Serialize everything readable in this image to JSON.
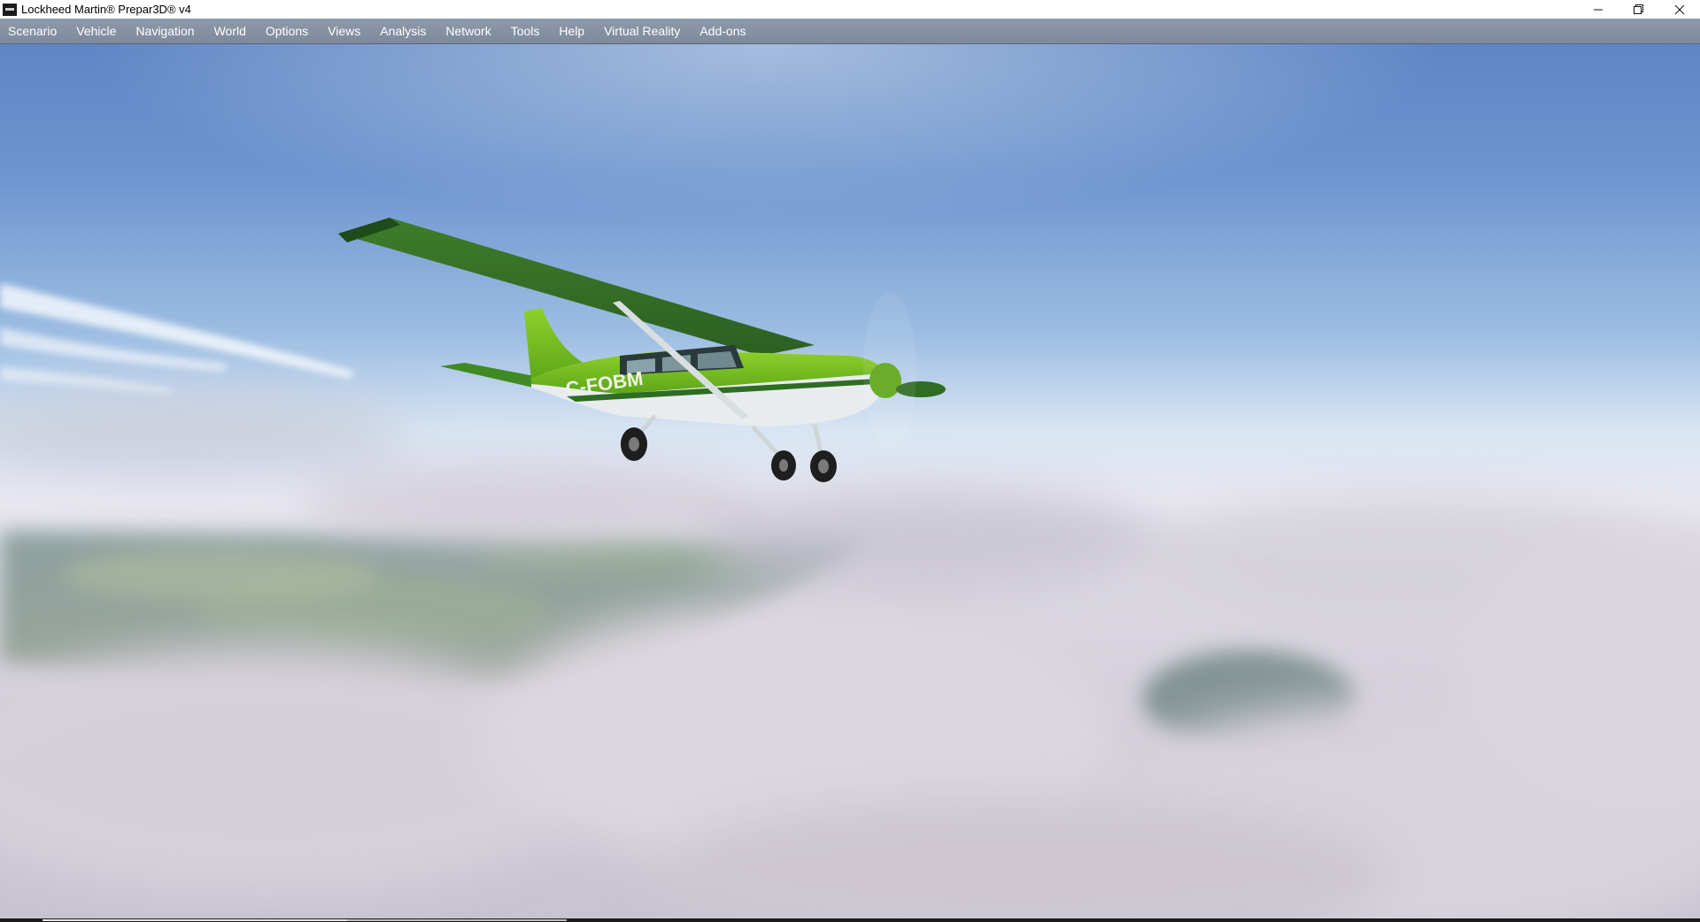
{
  "window": {
    "title": "Lockheed Martin® Prepar3D® v4",
    "app_icon": "prepar3d-app-icon",
    "controls": [
      "minimize-icon",
      "restore-icon",
      "close-icon"
    ]
  },
  "menu": {
    "items": [
      {
        "label": "Scenario"
      },
      {
        "label": "Vehicle"
      },
      {
        "label": "Navigation"
      },
      {
        "label": "World"
      },
      {
        "label": "Options"
      },
      {
        "label": "Views"
      },
      {
        "label": "Analysis"
      },
      {
        "label": "Network"
      },
      {
        "label": "Tools"
      },
      {
        "label": "Help"
      },
      {
        "label": "Virtual Reality"
      },
      {
        "label": "Add-ons"
      }
    ]
  },
  "scene": {
    "aircraft_registration": "C-FOBM",
    "colors": {
      "sky_top": "#5e86c4",
      "haze": "#e9e8f1",
      "cloud": "#d9d3de",
      "aircraft_green": "#6fba1e",
      "aircraft_dark_green": "#2e6d22",
      "fuselage_white": "#e8ecef"
    }
  }
}
